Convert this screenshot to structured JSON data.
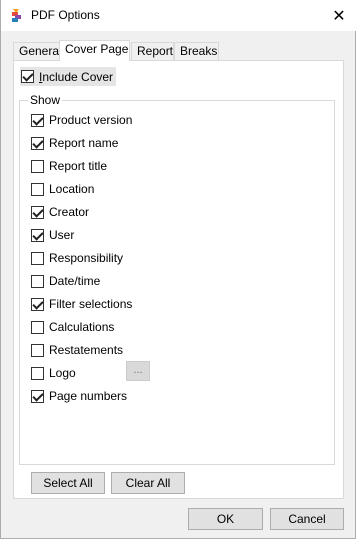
{
  "window": {
    "title": "PDF Options",
    "close_glyph": "✕"
  },
  "tabs": [
    {
      "label": "General"
    },
    {
      "label": "Cover Page",
      "active": true
    },
    {
      "label": "Report"
    },
    {
      "label": "Breaks"
    }
  ],
  "cover": {
    "include_cover_label": "Include Cover",
    "include_cover_checked": true,
    "group_label": "Show",
    "options": [
      {
        "label": "Product version",
        "checked": true
      },
      {
        "label": "Report name",
        "checked": true
      },
      {
        "label": "Report title",
        "checked": false
      },
      {
        "label": "Location",
        "checked": false
      },
      {
        "label": "Creator",
        "checked": true
      },
      {
        "label": "User",
        "checked": true
      },
      {
        "label": "Responsibility",
        "checked": false
      },
      {
        "label": "Date/time",
        "checked": false
      },
      {
        "label": "Filter selections",
        "checked": true
      },
      {
        "label": "Calculations",
        "checked": false
      },
      {
        "label": "Restatements",
        "checked": false
      },
      {
        "label": "Logo",
        "checked": false
      },
      {
        "label": "Page numbers",
        "checked": true
      }
    ],
    "logo_browse_label": "...",
    "select_all_label": "Select All",
    "clear_all_label": "Clear All"
  },
  "footer": {
    "ok_label": "OK",
    "cancel_label": "Cancel"
  },
  "colors": {
    "window_bg": "#f0f0f0",
    "panel_bg": "#ffffff",
    "button_bg": "#e1e1e1",
    "button_border": "#adadad"
  },
  "icons": {
    "app": "app-logo-icon",
    "close": "close-icon",
    "check": "checkmark-icon"
  }
}
